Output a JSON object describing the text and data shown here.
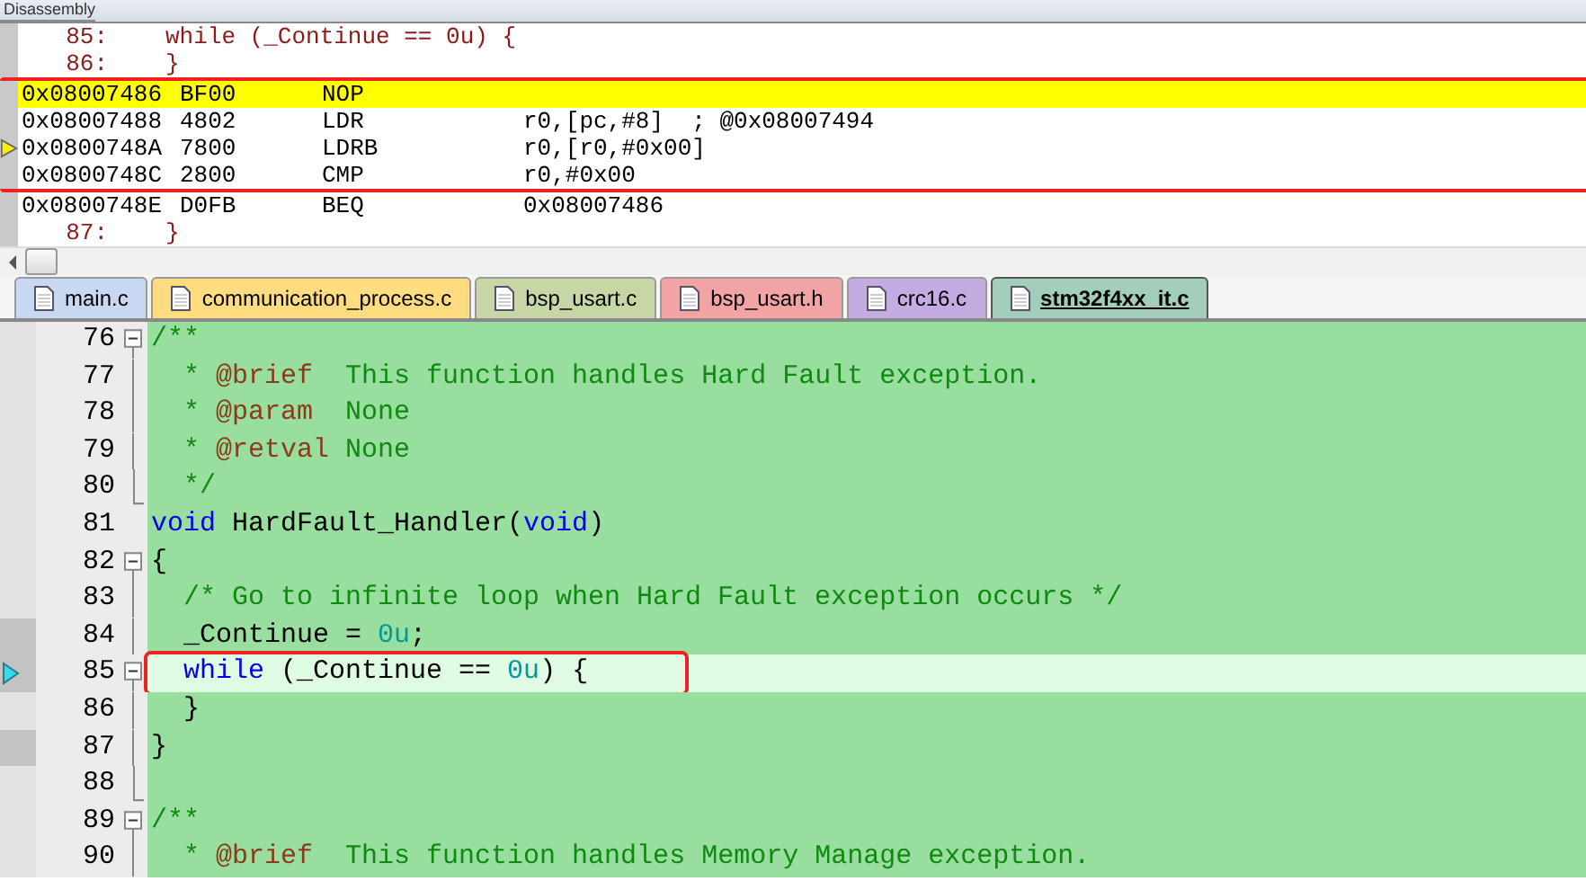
{
  "disassembly": {
    "title": "Disassembly",
    "rows": [
      {
        "kind": "source",
        "line": "85:",
        "text": "while (_Continue == 0u) {",
        "current": false,
        "pointer": false
      },
      {
        "kind": "source",
        "line": "86:",
        "text": "}",
        "current": false,
        "pointer": false
      },
      {
        "kind": "instr",
        "address": "0x08007486",
        "opcode": "BF00",
        "mnemonic": "NOP",
        "current": true,
        "pointer": false,
        "framed": true
      },
      {
        "kind": "instr",
        "address": "0x08007488",
        "opcode": "4802",
        "mnemonic": "LDR",
        "operands": "r0,[pc,#8]  ; @0x08007494",
        "current": false,
        "pointer": false,
        "framed": true
      },
      {
        "kind": "instr",
        "address": "0x0800748A",
        "opcode": "7800",
        "mnemonic": "LDRB",
        "operands": "r0,[r0,#0x00]",
        "current": false,
        "pointer": true,
        "framed": true
      },
      {
        "kind": "instr",
        "address": "0x0800748C",
        "opcode": "2800",
        "mnemonic": "CMP",
        "operands": "r0,#0x00",
        "current": false,
        "pointer": false,
        "framed": true
      },
      {
        "kind": "instr",
        "address": "0x0800748E",
        "opcode": "D0FB",
        "mnemonic": "BEQ",
        "operands": "0x08007486",
        "current": false,
        "pointer": false
      },
      {
        "kind": "source",
        "line": "87:",
        "text": "}",
        "current": false,
        "pointer": false
      }
    ]
  },
  "tabs": [
    {
      "label": "main.c",
      "color": "#c8d8f2",
      "selected": false
    },
    {
      "label": "communication_process.c",
      "color": "#ffdc80",
      "selected": false
    },
    {
      "label": "bsp_usart.c",
      "color": "#c6d6a4",
      "selected": false
    },
    {
      "label": "bsp_usart.h",
      "color": "#f2a4a4",
      "selected": false
    },
    {
      "label": "crc16.c",
      "color": "#c4abe2",
      "selected": false
    },
    {
      "label": "stm32f4xx_it.c",
      "color": "#a2ceba",
      "selected": true
    }
  ],
  "editor": {
    "lines": [
      {
        "number": "76",
        "kind": "start",
        "current": false,
        "gutter_mark": false,
        "tokens": [
          {
            "kind": "comment",
            "text": "/**"
          }
        ]
      },
      {
        "number": "77",
        "kind": "body",
        "current": false,
        "gutter_mark": false,
        "tokens": [
          {
            "kind": "comment",
            "text": "  * "
          },
          {
            "kind": "tag",
            "text": "@brief"
          },
          {
            "kind": "comment",
            "text": "  This function handles Hard Fault exception."
          }
        ]
      },
      {
        "number": "78",
        "kind": "body",
        "current": false,
        "gutter_mark": false,
        "tokens": [
          {
            "kind": "comment",
            "text": "  * "
          },
          {
            "kind": "tag",
            "text": "@param"
          },
          {
            "kind": "comment",
            "text": "  None"
          }
        ]
      },
      {
        "number": "79",
        "kind": "body",
        "current": false,
        "gutter_mark": false,
        "tokens": [
          {
            "kind": "comment",
            "text": "  * "
          },
          {
            "kind": "tag",
            "text": "@retval"
          },
          {
            "kind": "comment",
            "text": " None"
          }
        ]
      },
      {
        "number": "80",
        "kind": "end",
        "current": false,
        "gutter_mark": false,
        "tokens": [
          {
            "kind": "comment",
            "text": "  */"
          }
        ]
      },
      {
        "number": "81",
        "kind": "plain",
        "current": false,
        "gutter_mark": false,
        "tokens": [
          {
            "kind": "keyword",
            "text": "void"
          },
          {
            "kind": "plain",
            "text": " HardFault_Handler("
          },
          {
            "kind": "keyword",
            "text": "void"
          },
          {
            "kind": "plain",
            "text": ")"
          }
        ]
      },
      {
        "number": "82",
        "kind": "start",
        "current": false,
        "gutter_mark": false,
        "tokens": [
          {
            "kind": "plain",
            "text": "{"
          }
        ]
      },
      {
        "number": "83",
        "kind": "body",
        "current": false,
        "gutter_mark": false,
        "tokens": [
          {
            "kind": "comment",
            "text": "  /* Go to infinite loop when Hard Fault exception occurs */"
          }
        ]
      },
      {
        "number": "84",
        "kind": "body",
        "current": false,
        "gutter_mark": true,
        "tokens": [
          {
            "kind": "plain",
            "text": "  _Continue = "
          },
          {
            "kind": "number",
            "text": "0u"
          },
          {
            "kind": "plain",
            "text": ";"
          }
        ]
      },
      {
        "number": "85",
        "kind": "start",
        "current": true,
        "gutter_mark": true,
        "tokens": [
          {
            "kind": "keyword",
            "text": "  while"
          },
          {
            "kind": "plain",
            "text": " (_Continue == "
          },
          {
            "kind": "number",
            "text": "0u"
          },
          {
            "kind": "plain",
            "text": ") {"
          }
        ]
      },
      {
        "number": "86",
        "kind": "body",
        "current": false,
        "gutter_mark": false,
        "tokens": [
          {
            "kind": "plain",
            "text": "  }"
          }
        ]
      },
      {
        "number": "87",
        "kind": "body",
        "current": false,
        "gutter_mark": true,
        "tokens": [
          {
            "kind": "plain",
            "text": "}"
          }
        ]
      },
      {
        "number": "88",
        "kind": "end",
        "current": false,
        "gutter_mark": false
      },
      {
        "number": "89",
        "kind": "start",
        "current": false,
        "gutter_mark": false,
        "tokens": [
          {
            "kind": "comment",
            "text": "/**"
          }
        ]
      },
      {
        "number": "90",
        "kind": "body",
        "current": false,
        "gutter_mark": false,
        "tokens": [
          {
            "kind": "comment",
            "text": "  * "
          },
          {
            "kind": "tag",
            "text": "@brief"
          },
          {
            "kind": "comment",
            "text": "  This function handles Memory Manage exception."
          }
        ]
      }
    ]
  }
}
